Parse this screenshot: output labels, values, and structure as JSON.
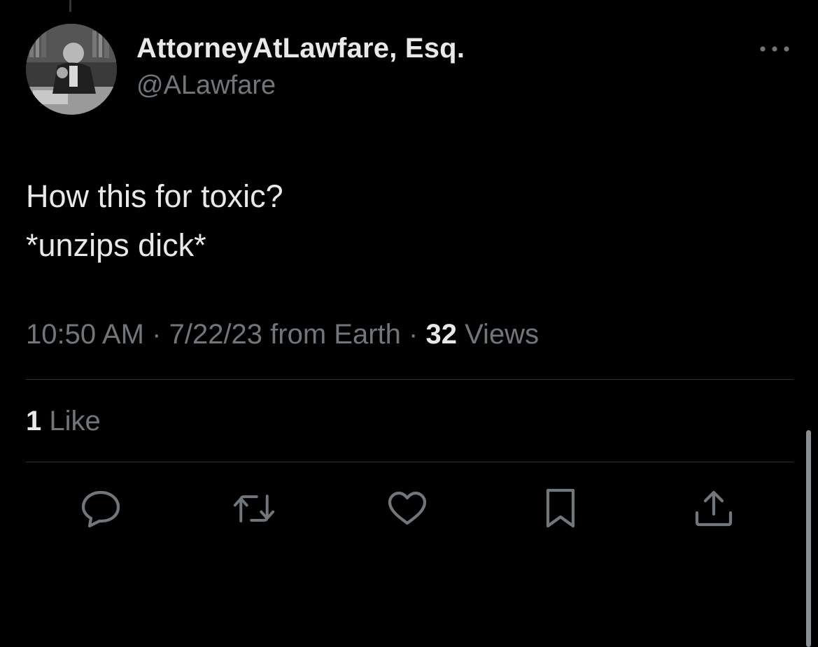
{
  "tweet": {
    "author": {
      "display_name": "AttorneyAtLawfare, Esq.",
      "handle": "@ALawfare",
      "avatar": "avatar-photo"
    },
    "text_lines": [
      "How this for toxic?",
      "*unzips dick*"
    ],
    "meta": {
      "time": "10:50 AM",
      "separator": "·",
      "date_source": "7/22/23 from Earth",
      "views_count": "32",
      "views_label": "Views"
    },
    "likes": {
      "count": "1",
      "label": "Like"
    },
    "actions": [
      {
        "name": "reply",
        "icon": "reply-icon"
      },
      {
        "name": "retweet",
        "icon": "retweet-icon"
      },
      {
        "name": "like",
        "icon": "heart-icon"
      },
      {
        "name": "bookmark",
        "icon": "bookmark-icon"
      },
      {
        "name": "share",
        "icon": "share-icon"
      }
    ],
    "more_icon": "more-icon"
  },
  "colors": {
    "background": "#000000",
    "primary_text": "#e7e9ea",
    "secondary_text": "#71767b",
    "divider": "#2f3336"
  }
}
